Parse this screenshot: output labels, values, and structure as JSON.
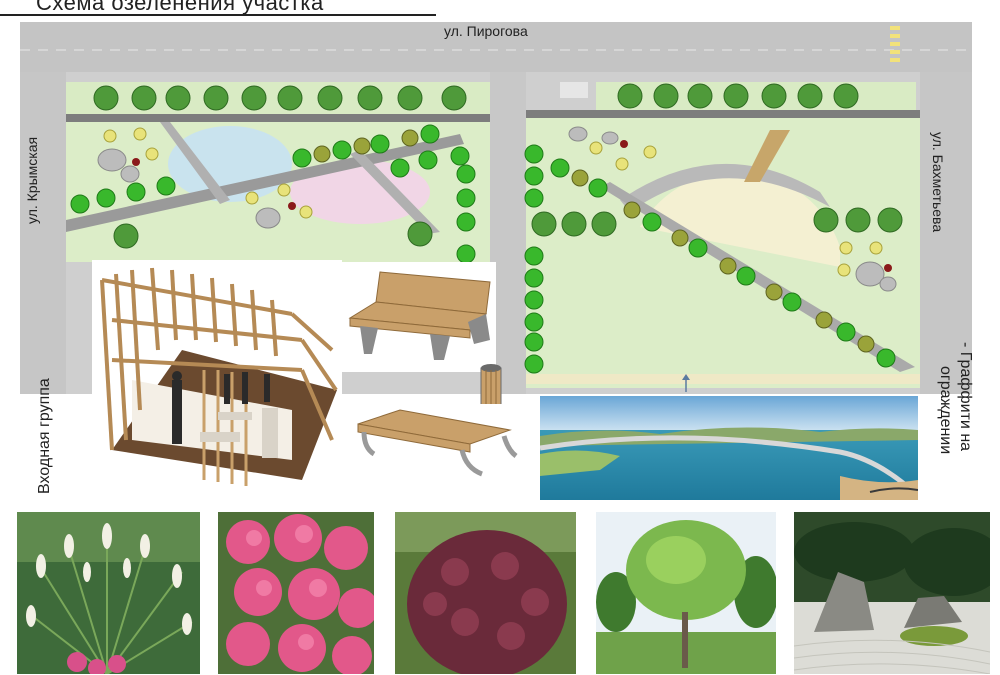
{
  "title": "Схема озеленения участка",
  "streets": {
    "top": "ул. Пирогова",
    "left": "ул. Крымская",
    "right": "ул. Бахметьева"
  },
  "side_labels": {
    "left": "Входная группа",
    "right_line1": "- Граффити на",
    "right_line2": "ограждении"
  },
  "photos": [
    {
      "name": "pampas-grass-photo"
    },
    {
      "name": "sedum-flowers-photo"
    },
    {
      "name": "purple-bush-photo"
    },
    {
      "name": "round-tree-photo"
    },
    {
      "name": "rock-garden-photo"
    }
  ]
}
